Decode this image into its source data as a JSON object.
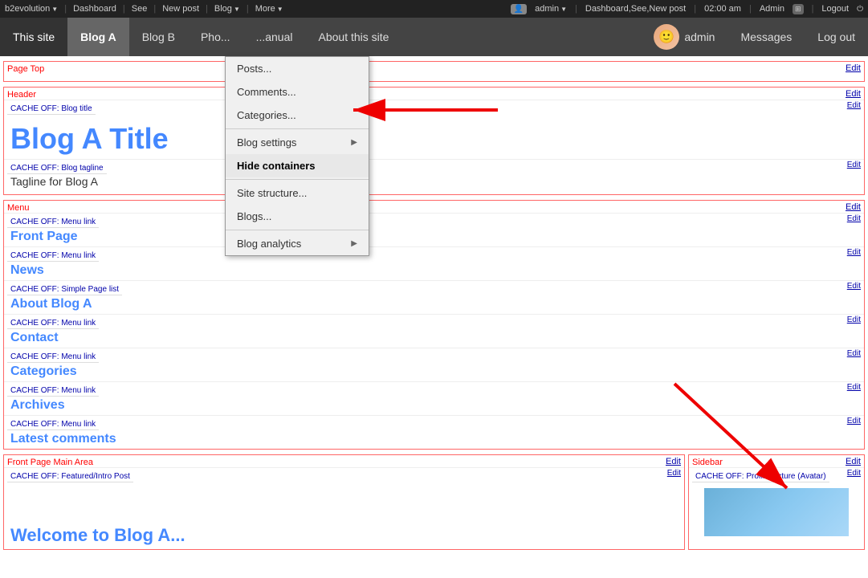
{
  "adminBar": {
    "siteName": "b2evolution",
    "navItems": [
      "Dashboard",
      "See",
      "New post"
    ],
    "blogMenu": "Blog",
    "moreMenu": "More",
    "time": "02:00 am",
    "adminUser": "Admin",
    "logoutLabel": "Logout"
  },
  "siteNav": {
    "thisSite": "This site",
    "items": [
      "Blog A",
      "Blog B",
      "Pho...",
      "...anual",
      "About this site"
    ],
    "adminLabel": "admin",
    "messagesLabel": "Messages",
    "logoutLabel": "Log out"
  },
  "blogMenu": {
    "items": [
      {
        "label": "Posts...",
        "hasArrow": false
      },
      {
        "label": "Comments...",
        "hasArrow": false
      },
      {
        "label": "Categories...",
        "hasArrow": false
      },
      {
        "label": "Blog settings",
        "hasArrow": true
      },
      {
        "label": "Hide containers",
        "hasArrow": false,
        "highlighted": true
      },
      {
        "label": "Site structure...",
        "hasArrow": false
      },
      {
        "label": "Blogs...",
        "hasArrow": false
      },
      {
        "label": "Blog analytics",
        "hasArrow": true
      }
    ]
  },
  "pageTop": {
    "sectionLabel": "Page Top",
    "editLabel": "Edit"
  },
  "header": {
    "sectionLabel": "Header",
    "editLabel": "Edit",
    "blogTitleCache": "CACHE OFF: Blog title",
    "blogTitleEditLabel": "Edit",
    "blogTitle": "Blog A Title",
    "blogTaglineCache": "CACHE OFF: Blog tagline",
    "blogTaglineEditLabel": "Edit",
    "blogTagline": "Tagline for Blog A"
  },
  "menu": {
    "sectionLabel": "Menu",
    "editLabel": "Edit",
    "items": [
      {
        "cache": "CACHE OFF: Menu link",
        "text": "Front Page",
        "editLabel": "Edit"
      },
      {
        "cache": "CACHE OFF: Menu link",
        "text": "News",
        "editLabel": "Edit"
      },
      {
        "cache": "CACHE OFF: Simple Page list",
        "text": "About Blog A",
        "editLabel": "Edit"
      },
      {
        "cache": "CACHE OFF: Menu link",
        "text": "Contact",
        "editLabel": "Edit"
      },
      {
        "cache": "CACHE OFF: Menu link",
        "text": "Categories",
        "editLabel": "Edit"
      },
      {
        "cache": "CACHE OFF: Menu link",
        "text": "Archives",
        "editLabel": "Edit"
      },
      {
        "cache": "CACHE OFF: Menu link",
        "text": "Latest comments",
        "editLabel": "Edit"
      }
    ]
  },
  "frontPageMain": {
    "sectionLabel": "Front Page Main Area",
    "editLabel": "Edit",
    "featuredCache": "CACHE OFF: Featured/Intro Post",
    "featuredEditLabel": "Edit"
  },
  "sidebar": {
    "sectionLabel": "Sidebar",
    "editLabel": "Edit",
    "avatarCache": "CACHE OFF: Profile picture (Avatar)",
    "avatarEditLabel": "Edit"
  },
  "partialTitle": "Welcome to Blog A..."
}
